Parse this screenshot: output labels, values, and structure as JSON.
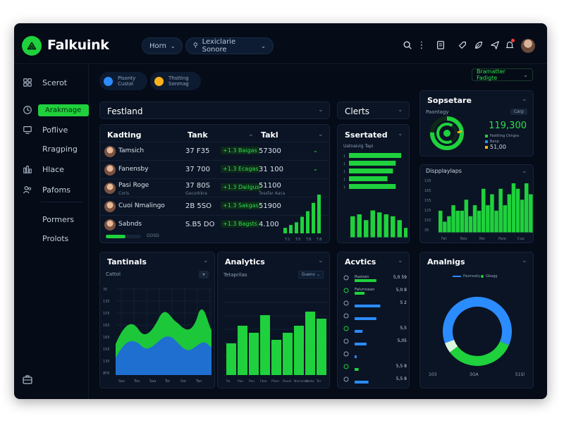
{
  "app": {
    "brand": "Falkuink"
  },
  "header": {
    "nav_pill": "Horn",
    "search_placeholder": "Lexiclarie Sonore",
    "icons": [
      "search-icon",
      "more-vertical-icon",
      "document-icon",
      "tag-icon",
      "leaf-icon",
      "send-icon",
      "bell-icon"
    ]
  },
  "sidebar": {
    "items": [
      {
        "label": "Scerot",
        "icon": "grid-icon"
      },
      {
        "label": "Arakmage",
        "icon": "clock-icon",
        "active": true
      },
      {
        "label": "Poflive",
        "icon": "monitor-icon"
      },
      {
        "label": "Rragping",
        "icon": ""
      },
      {
        "label": "Hlace",
        "icon": "bars-icon"
      },
      {
        "label": "Pafoms",
        "icon": "users-icon"
      },
      {
        "label": "Pormers",
        "icon": ""
      },
      {
        "label": "Prolots",
        "icon": ""
      }
    ],
    "footer_icon": "briefcase-icon"
  },
  "chips": [
    {
      "line1": "Pisonty",
      "line2": "Custal",
      "color": "#2b8cff"
    },
    {
      "line1": "Thstting",
      "line2": "Sonmag",
      "color": "#ffb21a"
    }
  ],
  "toolbar": {
    "filter_label": "Bramatter Fadigte"
  },
  "festland": {
    "title": "Festland"
  },
  "clients": {
    "title": "Clerts"
  },
  "table": {
    "headers": [
      "Kadting",
      "Tank",
      "Takl"
    ],
    "rows": [
      {
        "name": "Tamsich",
        "sub": "",
        "value": "37 F35",
        "badge": "+1.3 Baigas",
        "total": "57300",
        "total_sub": ""
      },
      {
        "name": "Fanensby",
        "sub": "",
        "value": "37 700",
        "badge": "+1.3 Ecagas",
        "total": "31 100",
        "total_sub": ""
      },
      {
        "name": "Pasi Roge",
        "sub": "Coris",
        "value": "37 80S",
        "value_sub": "Gacurkkra",
        "badge": "+1.3 Dailgus",
        "total": "51100",
        "total_sub": "Tossfar Aaca"
      },
      {
        "name": "Cuoi Nmalingo",
        "sub": "",
        "value": "2B 5SO",
        "badge": "+1.3 Sakgas",
        "total": "51900",
        "total_sub": ""
      },
      {
        "name": "Sabnds",
        "sub": "",
        "value": "S.B5 DO",
        "badge": "+1.3 Bagsts",
        "total": "4.100",
        "total_sub": ""
      }
    ],
    "progress_label": "GOSD",
    "progress": 0.55
  },
  "mini_bars": {
    "values": [
      2,
      3,
      4,
      6,
      8,
      11,
      14
    ],
    "labels": [
      "T:1",
      "T:0",
      "T:8",
      "T:8"
    ]
  },
  "spectated": {
    "title": "Ssertated",
    "subtitle": "Uatnaivig Tapi",
    "bars": [
      0.95,
      0.85,
      0.8,
      0.7,
      0.85
    ],
    "columns": [
      0.55,
      0.6,
      0.45,
      0.7,
      0.65,
      0.6,
      0.55,
      0.45,
      0.25
    ]
  },
  "sopsetare": {
    "title": "Sopsetare",
    "label": "Paontagy",
    "tag": "Carp",
    "value": "119,300",
    "legend": [
      {
        "label": "Fasttling Ctingra",
        "color": "#1fd13c"
      },
      {
        "label": "Banp",
        "color": "#2b8cff"
      },
      {
        "label": "51,00",
        "color": "#ffb21a"
      }
    ]
  },
  "displays": {
    "title": "Dispplaylaps",
    "yticks": [
      "135",
      "165",
      "155",
      "125",
      "155",
      "35"
    ],
    "xticks": [
      "Fat",
      "Bao",
      "Roi",
      "Pare",
      "Cuo"
    ],
    "values": [
      4,
      2,
      3,
      5,
      4,
      4,
      6,
      3,
      5,
      4,
      8,
      5,
      7,
      4,
      8,
      5,
      7,
      9,
      8,
      6,
      9,
      7
    ]
  },
  "terminals": {
    "title": "Tantinals",
    "select": "Cattol",
    "yticks": [
      "35",
      "135",
      "155",
      "165",
      "165",
      "155",
      "135",
      "8F8"
    ],
    "xticks": [
      "Sav",
      "Tou",
      "Saa",
      "Tor",
      "Sar",
      "Tan"
    ]
  },
  "analytics": {
    "title": "Analytics",
    "subtitle": "Tetaprilas",
    "select": "Guenv",
    "values": [
      45,
      70,
      60,
      85,
      50,
      60,
      70,
      90,
      80
    ],
    "xticks": [
      "Pa",
      "Pae",
      "Pon",
      "Fbar",
      "Pianr",
      "Rouel",
      "Norrenne",
      "Aosta",
      "Tor"
    ]
  },
  "activity": {
    "title": "Acvtics",
    "rows": [
      {
        "label": "Razoan",
        "value": "5,0 59",
        "bar": 0.55,
        "color": "#1fd13c"
      },
      {
        "label": "Falvrinaan",
        "value": "5,0 8",
        "bar": 0.25,
        "color": "#1fd13c"
      },
      {
        "label": "",
        "value": "5 2",
        "bar": 0.65,
        "color": "#2b8cff"
      },
      {
        "label": "",
        "value": "",
        "bar": 0.55,
        "color": "#2b8cff"
      },
      {
        "label": "",
        "value": "5,5",
        "bar": 0.2,
        "color": "#2b8cff"
      },
      {
        "label": "",
        "value": "5,05",
        "bar": 0.3,
        "color": "#2b8cff"
      },
      {
        "label": "",
        "value": "",
        "bar": 0.05,
        "color": "#2b8cff"
      },
      {
        "label": "",
        "value": "5,5 8",
        "bar": 0.1,
        "color": "#1fd13c"
      },
      {
        "label": "",
        "value": "5,5 8",
        "bar": 0.35,
        "color": "#2b8cff"
      }
    ],
    "icons": [
      "heart-icon",
      "leaf-icon",
      "mic-icon",
      "pin-icon",
      "pin-icon",
      "cart-icon",
      "mic-icon"
    ]
  },
  "donut": {
    "title": "Analnigs",
    "legend": [
      "Fasmoaty",
      "Gbagg"
    ],
    "segments": [
      {
        "value": 0.62,
        "color": "#2b8cff"
      },
      {
        "value": 0.33,
        "color": "#1fd13c"
      },
      {
        "value": 0.05,
        "color": "#d9f5dd"
      }
    ],
    "footer_left": "103",
    "footer_mid": "3GA",
    "footer_right": "51Sl"
  }
}
